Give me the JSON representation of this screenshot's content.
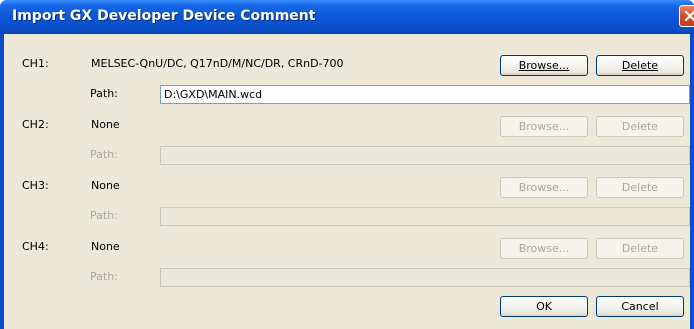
{
  "dialog": {
    "title": "Import GX Developer Device Comment"
  },
  "channels": [
    {
      "label": "CH1:",
      "device": "MELSEC-QnU/DC, Q17nD/M/NC/DR, CRnD-700",
      "path_label": "Path:",
      "path_value": "D:\\GXD\\MAIN.wcd",
      "browse_label": "Browse...",
      "delete_label": "Delete",
      "enabled": true
    },
    {
      "label": "CH2:",
      "device": "None",
      "path_label": "Path:",
      "path_value": "",
      "browse_label": "Browse...",
      "delete_label": "Delete",
      "enabled": false
    },
    {
      "label": "CH3:",
      "device": "None",
      "path_label": "Path:",
      "path_value": "",
      "browse_label": "Browse...",
      "delete_label": "Delete",
      "enabled": false
    },
    {
      "label": "CH4:",
      "device": "None",
      "path_label": "Path:",
      "path_value": "",
      "browse_label": "Browse...",
      "delete_label": "Delete",
      "enabled": false
    }
  ],
  "footer": {
    "ok_label": "OK",
    "cancel_label": "Cancel"
  },
  "colors": {
    "titlebar": "#0a54d6",
    "dialog_bg": "#ece9d8",
    "close_button": "#c23d1a",
    "disabled_text": "#aca899"
  },
  "icons": {
    "close": "close-icon"
  }
}
